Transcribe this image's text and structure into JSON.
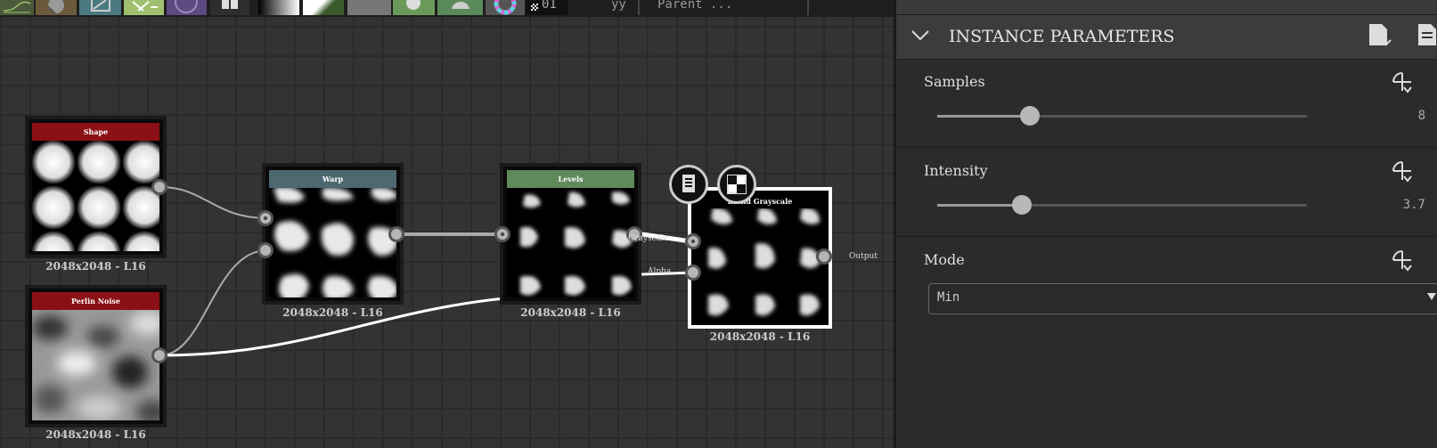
{
  "toolbar": {
    "text_a": "yy",
    "text_b": "Parent ...",
    "counter": "01"
  },
  "graph": {
    "nodes": [
      {
        "title": "Shape",
        "resolution": "2048x2048 - L16",
        "color": "#8b1015"
      },
      {
        "title": "Perlin Noise",
        "resolution": "2048x2048 - L16",
        "color": "#8b1015"
      },
      {
        "title": "Warp",
        "resolution": "2048x2048 - L16",
        "color": "#4d6870"
      },
      {
        "title": "Levels",
        "resolution": "2048x2048 - L16",
        "color": "#5e8a5c"
      },
      {
        "title": "Blend Grayscale",
        "resolution": "2048x2048 - L16"
      }
    ],
    "port_labels": {
      "grayscale": "Grayscale",
      "alpha": "Alpha",
      "output": "Output"
    }
  },
  "panel": {
    "title": "INSTANCE PARAMETERS",
    "params": [
      {
        "label": "Samples",
        "value": "8",
        "fraction": 0.25
      },
      {
        "label": "Intensity",
        "value": "3.7",
        "fraction": 0.23
      },
      {
        "label": "Mode",
        "value": "Min"
      }
    ]
  },
  "icons": [
    "chevron-down-icon",
    "preset-icon",
    "document-icon",
    "reset-icon",
    "checker-icon"
  ]
}
